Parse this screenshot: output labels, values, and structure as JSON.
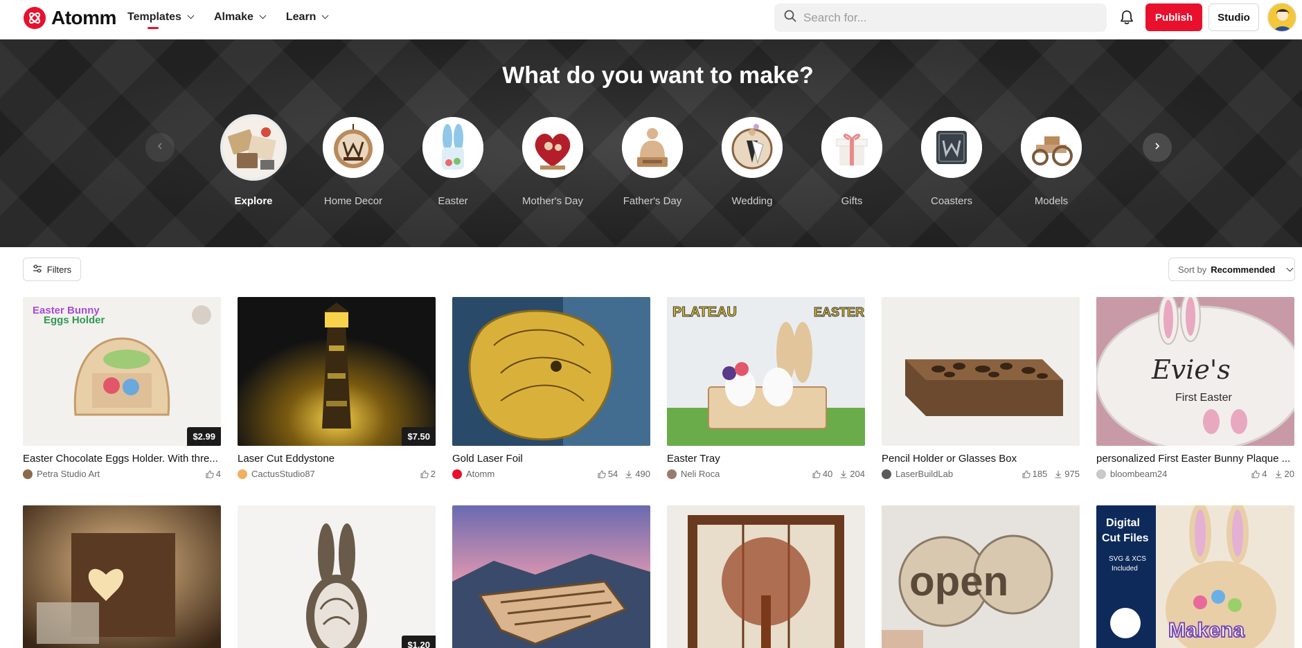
{
  "app": {
    "name": "Atomm"
  },
  "nav": {
    "items": [
      {
        "label": "Templates"
      },
      {
        "label": "Almake"
      },
      {
        "label": "Learn"
      }
    ]
  },
  "search": {
    "placeholder": "Search for..."
  },
  "actions": {
    "publish": "Publish",
    "studio": "Studio"
  },
  "hero": {
    "title": "What do you want to make?",
    "categories": [
      {
        "label": "Explore"
      },
      {
        "label": "Home Decor"
      },
      {
        "label": "Easter"
      },
      {
        "label": "Mother's Day"
      },
      {
        "label": "Father's Day"
      },
      {
        "label": "Wedding"
      },
      {
        "label": "Gifts"
      },
      {
        "label": "Coasters"
      },
      {
        "label": "Models"
      }
    ]
  },
  "toolbar": {
    "filters": "Filters",
    "sort_prefix": "Sort by",
    "sort_value": "Recommended"
  },
  "cards": [
    {
      "title": "Easter Chocolate Eggs Holder. With thre...",
      "author": "Petra Studio Art",
      "price": "$2.99",
      "likes": "4",
      "downloads": ""
    },
    {
      "title": "Laser Cut Eddystone",
      "author": "CactusStudio87",
      "price": "$7.50",
      "likes": "2",
      "downloads": ""
    },
    {
      "title": "Gold Laser Foil",
      "author": "Atomm",
      "price": "",
      "likes": "54",
      "downloads": "490"
    },
    {
      "title": "Easter Tray",
      "author": "Neli Roca",
      "price": "",
      "likes": "40",
      "downloads": "204"
    },
    {
      "title": "Pencil Holder or Glasses Box",
      "author": "LaserBuildLab",
      "price": "",
      "likes": "185",
      "downloads": "975"
    },
    {
      "title": "personalized First Easter Bunny Plaque ...",
      "author": "bloombeam24",
      "price": "",
      "likes": "4",
      "downloads": "20"
    },
    {
      "title": "",
      "author": "",
      "price": "",
      "likes": "",
      "downloads": ""
    },
    {
      "title": "",
      "author": "",
      "price": "$1.20",
      "likes": "",
      "downloads": ""
    },
    {
      "title": "",
      "author": "",
      "price": "",
      "likes": "",
      "downloads": ""
    },
    {
      "title": "",
      "author": "",
      "price": "",
      "likes": "",
      "downloads": ""
    },
    {
      "title": "",
      "author": "",
      "price": "",
      "likes": "",
      "downloads": ""
    },
    {
      "title": "",
      "author": "",
      "price": "",
      "likes": "",
      "downloads": ""
    }
  ],
  "card_images": {
    "c7": {
      "line1": "Digital",
      "line2": "Cut Files",
      "line3": "SVG & XCS",
      "line4": "Included",
      "name": "Makena"
    }
  },
  "colors": {
    "brand": "#e8102d",
    "hero_bg": "#2a2a2a"
  }
}
